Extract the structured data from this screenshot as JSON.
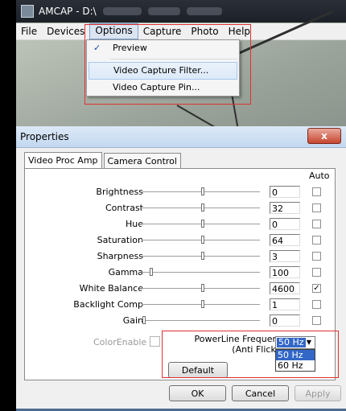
{
  "amcap": {
    "title": "AMCAP - D:\\",
    "menu": [
      "File",
      "Devices",
      "Options",
      "Capture",
      "Photo",
      "Help"
    ],
    "active_menu": "Options",
    "dropdown": {
      "items": [
        {
          "label": "Preview",
          "checked": true
        },
        {
          "label": "Video Capture Filter...",
          "highlighted": true
        },
        {
          "label": "Video Capture Pin..."
        }
      ]
    }
  },
  "properties": {
    "title": "Properties",
    "close_label": "x",
    "tabs": [
      {
        "label": "Video Proc Amp",
        "selected": true
      },
      {
        "label": "Camera Control",
        "selected": false
      }
    ],
    "auto_label": "Auto",
    "rows": [
      {
        "label": "Brightness",
        "value": "0",
        "slider_fraction": 0.52,
        "auto": false
      },
      {
        "label": "Contrast",
        "value": "32",
        "slider_fraction": 0.52,
        "auto": false
      },
      {
        "label": "Hue",
        "value": "0",
        "slider_fraction": 0.52,
        "auto": false
      },
      {
        "label": "Saturation",
        "value": "64",
        "slider_fraction": 0.52,
        "auto": false
      },
      {
        "label": "Sharpness",
        "value": "3",
        "slider_fraction": 0.52,
        "auto": false
      },
      {
        "label": "Gamma",
        "value": "100",
        "slider_fraction": 0.08,
        "auto": false
      },
      {
        "label": "White Balance",
        "value": "4600",
        "slider_fraction": 0.52,
        "auto": true
      },
      {
        "label": "Backlight Comp",
        "value": "1",
        "slider_fraction": 0.52,
        "auto": false
      },
      {
        "label": "Gain",
        "value": "0",
        "slider_fraction": 0.02,
        "auto": false
      }
    ],
    "color_enable_label": "ColorEnable",
    "powerline_label_1": "PowerLine Frequency",
    "powerline_label_2": "(Anti Flicker)",
    "powerline_selected": "50 Hz",
    "powerline_options": [
      "50 Hz",
      "60 Hz"
    ],
    "default_label": "Default",
    "ok_label": "OK",
    "cancel_label": "Cancel",
    "apply_label": "Apply"
  }
}
